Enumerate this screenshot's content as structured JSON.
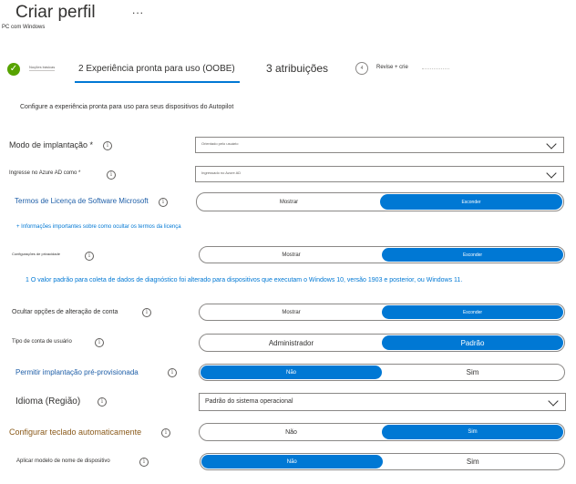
{
  "header": {
    "title": "Criar perfil",
    "more_label": "...",
    "subtitle": "PC com Windows"
  },
  "wizard": {
    "step1_label": "Noções básicas",
    "step2_label": "2 Experiência pronta para uso (OOBE)",
    "step3_label": "3 atribuições",
    "step4_number": "4",
    "step4_label": "Revise + crie"
  },
  "intro_text": "Configure a experiência pronta para uso para seus dispositivos do Autopilot",
  "fields": {
    "deployment_mode": {
      "label": "Modo de implantação *",
      "value": "Orientado pelo usuário"
    },
    "join_azure": {
      "label": "Ingresse no Azure AD como *",
      "value": "Ingressado no Azure AD"
    },
    "license_terms": {
      "label": "Termos de Licença de Software Microsoft",
      "option_left": "Mostrar",
      "option_right": "Esconder",
      "selected": "right"
    },
    "more_info_link": "+ Informações importantes sobre como ocultar os termos da licença",
    "privacy": {
      "label": "Configurações de privacidade",
      "option_left": "Mostrar",
      "option_right": "Esconder",
      "selected": "right"
    },
    "diagnostic_notice": "1 O valor padrão para coleta de dados de diagnóstico foi alterado para dispositivos que executam o Windows 10, versão 1903 e posterior, ou Windows 11.",
    "hide_account_change": {
      "label": "Ocultar opções de alteração de conta",
      "option_left": "Mostrar",
      "option_right": "Esconder",
      "selected": "right"
    },
    "user_account_type": {
      "label": "Tipo de conta de usuário",
      "option_left": "Administrador",
      "option_right": "Padrão",
      "selected": "right"
    },
    "preprovisioned": {
      "label": "Permitir implantação pré-provisionada",
      "option_left": "Não",
      "option_right": "Sim",
      "selected": "left"
    },
    "language": {
      "label": "Idioma (Região)",
      "value": "Padrão do sistema operacional"
    },
    "keyboard": {
      "label": "Configurar teclado automaticamente",
      "option_left": "Não",
      "option_right": "Sim",
      "selected": "right"
    },
    "device_name": {
      "label": "Aplicar modelo de nome de dispositivo",
      "option_left": "Não",
      "option_right": "Sim",
      "selected": "left"
    }
  },
  "icons": {
    "info": "info-icon",
    "check": "checkmark-icon",
    "chevron": "chevron-down-icon"
  },
  "colors": {
    "accent": "#0078d4",
    "success": "#57a300"
  }
}
